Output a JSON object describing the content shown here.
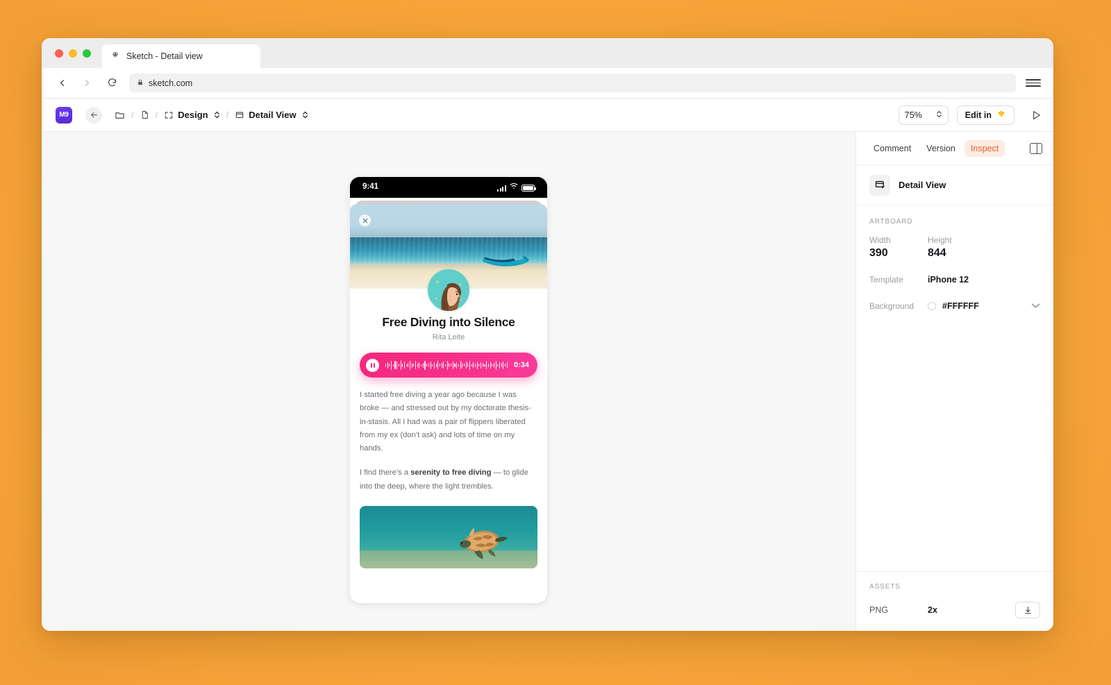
{
  "browser": {
    "tab_title": "Sketch - Detail view",
    "tab_icon": "sketch-diamond-icon",
    "url": "sketch.com",
    "lock_icon": "lock-icon",
    "back_icon": "back-arrow-icon",
    "forward_icon": "forward-arrow-icon",
    "reload_icon": "reload-icon",
    "menu_icon": "hamburger-menu-icon"
  },
  "toolbar": {
    "logo_text": "M9",
    "back_icon": "back-arrow-icon",
    "folder_icon": "folder-icon",
    "document_icon": "document-icon",
    "page_icon": "page-icon",
    "artboard_icon": "artboard-icon",
    "crumb_page": "Design",
    "crumb_artboard": "Detail View",
    "separator": "/",
    "zoom_value": "75%",
    "edit_label": "Edit in",
    "edit_icon": "sketch-diamond-icon",
    "play_icon": "play-icon"
  },
  "inspector": {
    "tabs": [
      {
        "label": "Comment",
        "active": false
      },
      {
        "label": "Version",
        "active": false
      },
      {
        "label": "Inspect",
        "active": true
      }
    ],
    "panel_toggle_icon": "panel-toggle-icon",
    "layer_icon": "artboard-icon",
    "layer_name": "Detail View",
    "artboard_section": "ARTBOARD",
    "width_label": "Width",
    "width_value": "390",
    "height_label": "Height",
    "height_value": "844",
    "template_label": "Template",
    "template_value": "iPhone 12",
    "background_label": "Background",
    "background_value": "#FFFFFF",
    "caret_icon": "chevron-down-icon",
    "assets_section": "ASSETS",
    "asset_format": "PNG",
    "asset_scale": "2x",
    "download_icon": "download-icon"
  },
  "phone": {
    "status_time": "9:41",
    "signal_icon": "cellular-signal-icon",
    "wifi_icon": "wifi-icon",
    "battery_icon": "battery-icon",
    "close_icon": "close-x-icon",
    "hero_alt": "beach-with-boat-photo",
    "avatar_alt": "author-portrait-avatar",
    "title": "Free Diving into Silence",
    "author": "Rita Leite",
    "player": {
      "pause_icon": "pause-icon",
      "waveform_icon": "audio-waveform",
      "duration": "0:34",
      "accent_color": "#F5277F"
    },
    "paragraph1": "I started free diving a year ago because I was broke — and stressed out by my doctorate thesis-in-stasis. All I had was a pair of flippers liberated from my ex (don’t ask) and lots of time on my hands.",
    "paragraph2_pre": "I find there’s a ",
    "paragraph2_bold": "serenity to free diving",
    "paragraph2_post": " — to glide into the deep, where the light trembles.",
    "photo2_alt": "sea-turtle-underwater-photo",
    "home_indicator": "home-indicator"
  },
  "colors": {
    "page_background": "#F5A93B",
    "canvas": "#F7F7F7",
    "accent_inspect": "#E4632A",
    "accent_inspect_bg": "#FDEBE2",
    "logo_purple": "#5429D6"
  }
}
